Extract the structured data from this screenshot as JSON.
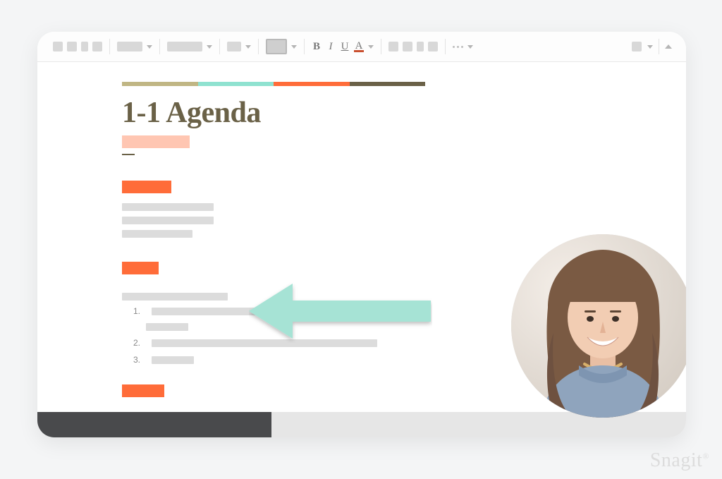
{
  "toolbar": {
    "bold": "B",
    "italic": "I",
    "underline": "U",
    "font_color_label": "A"
  },
  "document": {
    "title": "1-1 Agenda",
    "stripe_colors": [
      "#c0b684",
      "#8fe2d0",
      "#ff6c39",
      "#6a6147"
    ],
    "list_numbers": [
      "1.",
      "2.",
      "3."
    ]
  },
  "annotation": {
    "arrow_color": "#a6e3d5"
  },
  "watermark": "Snagit"
}
